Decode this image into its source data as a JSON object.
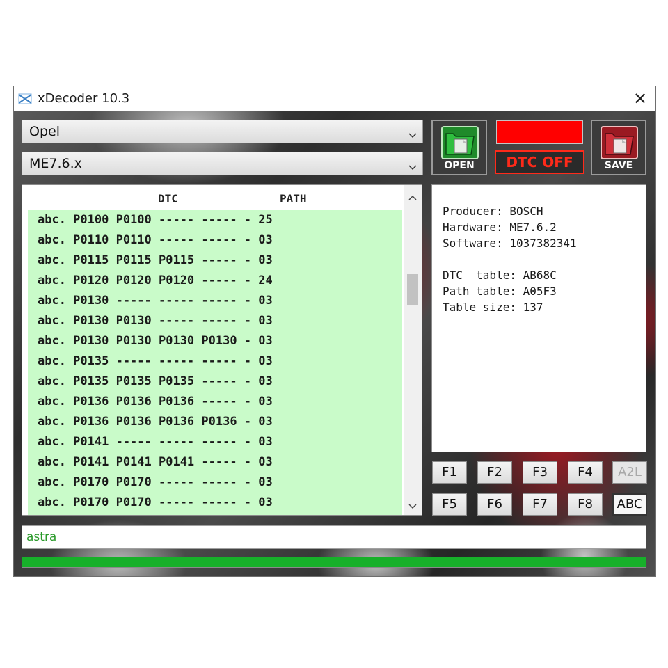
{
  "window": {
    "title": "xDecoder 10.3",
    "close_glyph": "✕"
  },
  "manufacturer_select": {
    "value": "Opel"
  },
  "ecu_select": {
    "value": "ME7.6.x"
  },
  "buttons": {
    "open_label": "OPEN",
    "save_label": "SAVE",
    "dtc_off_label": "DTC OFF",
    "status_color": "#ff0000"
  },
  "list": {
    "header_dtc": "DTC",
    "header_path": "PATH",
    "rows": [
      "abc. P0100 P0100 ----- ----- - 25",
      "abc. P0110 P0110 ----- ----- - 03",
      "abc. P0115 P0115 P0115 ----- - 03",
      "abc. P0120 P0120 P0120 ----- - 24",
      "abc. P0130 ----- ----- ----- - 03",
      "abc. P0130 P0130 ----- ----- - 03",
      "abc. P0130 P0130 P0130 P0130 - 03",
      "abc. P0135 ----- ----- ----- - 03",
      "abc. P0135 P0135 P0135 ----- - 03",
      "abc. P0136 P0136 P0136 ----- - 03",
      "abc. P0136 P0136 P0136 P0136 - 03",
      "abc. P0141 ----- ----- ----- - 03",
      "abc. P0141 P0141 P0141 ----- - 03",
      "abc. P0170 P0170 ----- ----- - 03",
      "abc. P0170 P0170 ----- ----- - 03"
    ]
  },
  "info": {
    "lines": [
      "Producer: BOSCH",
      "Hardware: ME7.6.2",
      "Software: 1037382341",
      "",
      "DTC  table: AB68C",
      "Path table: A05F3",
      "Table size: 137"
    ]
  },
  "function_keys": {
    "row1": [
      "F1",
      "F2",
      "F3",
      "F4",
      "A2L"
    ],
    "row2": [
      "F5",
      "F6",
      "F7",
      "F8",
      "ABC"
    ]
  },
  "search": {
    "value": "astra"
  },
  "progress": {
    "fraction": 1.0,
    "color": "#17b02a"
  },
  "icons": {
    "app": "xdecoder-app-icon",
    "open": "folder-open-icon",
    "save": "folder-save-icon",
    "combo_arrow": "chevron-down-icon"
  }
}
